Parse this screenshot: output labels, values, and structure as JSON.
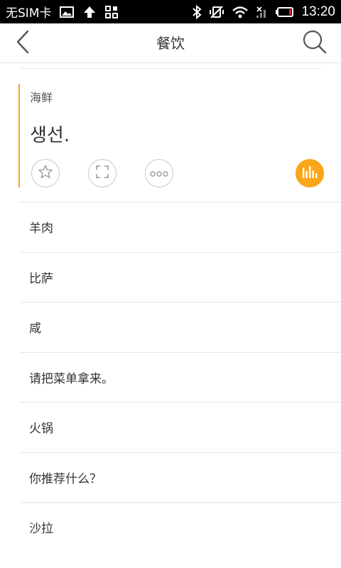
{
  "status_bar": {
    "carrier": "无SIM卡",
    "time": "13:20",
    "icons": [
      "image-icon",
      "upload-arrow-icon",
      "grid-icon",
      "bluetooth-icon",
      "vibrate-off-icon",
      "wifi-icon",
      "signal-icon",
      "battery-icon"
    ]
  },
  "header": {
    "title": "餐饮",
    "back_icon": "chevron-left-icon",
    "search_icon": "search-icon"
  },
  "card": {
    "category": "海鲜",
    "text": "생선.",
    "accent_color": "#f5a623",
    "actions": [
      "star-icon",
      "fullscreen-icon",
      "more-icon",
      "audio-icon"
    ]
  },
  "list": {
    "items": [
      "羊肉",
      "比萨",
      "咸",
      "请把菜单拿来。",
      "火锅",
      "你推荐什么？",
      "沙拉"
    ]
  },
  "colors": {
    "accent": "#fba51a",
    "text": "#333333",
    "divider": "#e6e6e6"
  }
}
